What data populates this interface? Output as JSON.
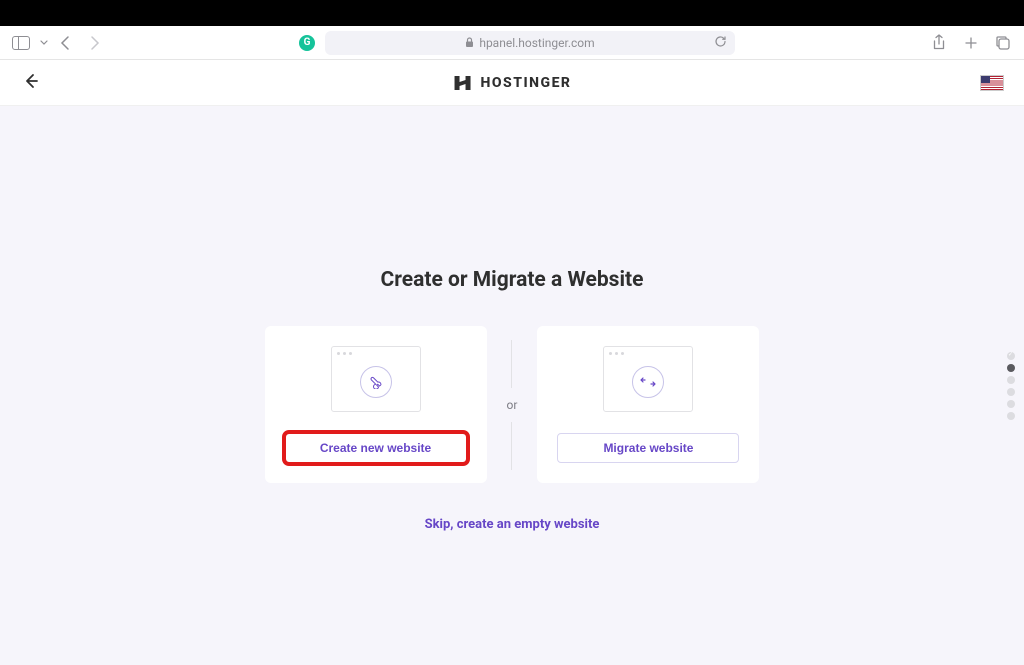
{
  "browser": {
    "url": "hpanel.hostinger.com"
  },
  "header": {
    "brand": "HOSTINGER",
    "locale": "us"
  },
  "main": {
    "title": "Create or Migrate a Website",
    "or_label": "or",
    "cards": {
      "create": {
        "button_label": "Create new website",
        "icon": "wrench"
      },
      "migrate": {
        "button_label": "Migrate website",
        "icon": "transfer"
      }
    },
    "skip_link": "Skip, create an empty website"
  },
  "progress": {
    "total": 6,
    "current": 2
  }
}
